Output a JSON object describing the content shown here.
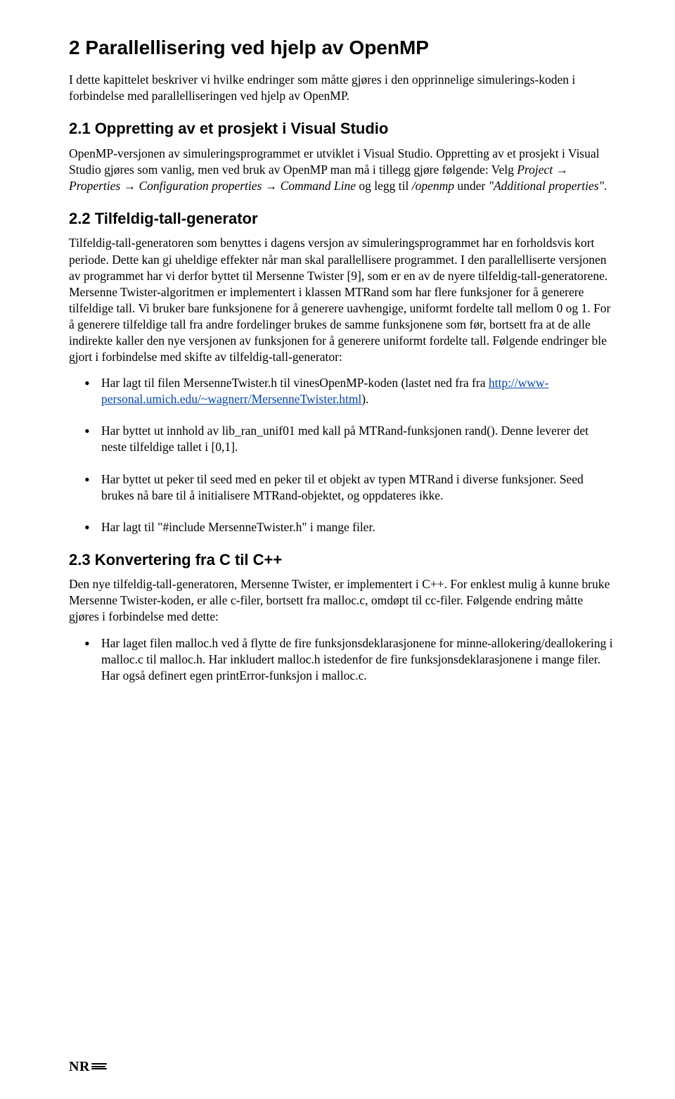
{
  "h1": "2  Parallellisering ved hjelp av OpenMP",
  "intro": "I dette kapittelet beskriver vi hvilke endringer som måtte gjøres i den opprinnelige simulerings-koden i forbindelse med parallelliseringen ved hjelp av OpenMP.",
  "s21": {
    "title": "2.1  Oppretting av et prosjekt i Visual Studio",
    "p_pre": "OpenMP-versjonen av simuleringsprogrammet er utviklet i Visual Studio. Oppretting av et prosjekt i Visual Studio gjøres som vanlig, men ved bruk av OpenMP man må i tillegg gjøre følgende: Velg ",
    "p_it1": "Project → Properties → Configuration properties → Command Line",
    "p_mid": " og legg til ",
    "p_it2": "/openmp",
    "p_post1": " under ",
    "p_it3": "\"Additional properties\"",
    "p_post2": "."
  },
  "s22": {
    "title": "2.2  Tilfeldig-tall-generator",
    "p1": "Tilfeldig-tall-generatoren som benyttes i dagens versjon av simuleringsprogrammet har en forholdsvis kort periode.  Dette kan gi uheldige effekter når man skal parallellisere programmet. I den parallelliserte versjonen av programmet har vi derfor byttet til Mersenne Twister [9], som er en av de nyere tilfeldig-tall-generatorene. Mersenne Twister-algoritmen er implementert i klassen MTRand som har flere funksjoner for å generere tilfeldige tall. Vi bruker bare funksjonene for å generere uavhengige, uniformt fordelte tall mellom 0 og 1. For å generere tilfeldige tall fra andre fordelinger brukes de samme funksjonene som før, bortsett fra at de alle indirekte kaller den nye versjonen av funksjonen for å generere uniformt fordelte tall. Følgende endringer ble gjort i forbindelse med skifte av tilfeldig-tall-generator:",
    "bullets": {
      "b1_pre": "Har lagt til filen MersenneTwister.h til vinesOpenMP-koden (lastet ned fra fra ",
      "b1_link": "http://www-personal.umich.edu/~wagnerr/MersenneTwister.html",
      "b1_post": ").",
      "b2": "Har byttet ut innhold av lib_ran_unif01 med kall på MTRand-funksjonen rand(). Denne leverer det neste tilfeldige tallet i [0,1].",
      "b3": "Har byttet ut peker til seed med en peker til et objekt av typen MTRand i diverse funksjoner. Seed brukes nå bare til å initialisere MTRand-objektet, og oppdateres ikke.",
      "b4": "Har lagt til \"#include MersenneTwister.h\" i mange filer."
    }
  },
  "s23": {
    "title": "2.3  Konvertering fra C til C++",
    "p1": "Den nye tilfeldig-tall-generatoren, Mersenne Twister, er implementert i C++. For enklest mulig å kunne bruke Mersenne Twister-koden, er alle c-filer, bortsett fra malloc.c, omdøpt til cc-filer. Følgende endring måtte gjøres i forbindelse med dette:",
    "bullets": {
      "b1": "Har laget filen malloc.h ved å flytte de fire funksjonsdeklarasjonene for minne-allokering/deallokering i malloc.c til malloc.h.  Har inkludert malloc.h istedenfor de fire funksjonsdeklarasjonene i mange filer. Har også definert egen printError-funksjon i malloc.c."
    }
  },
  "logo": "NR"
}
